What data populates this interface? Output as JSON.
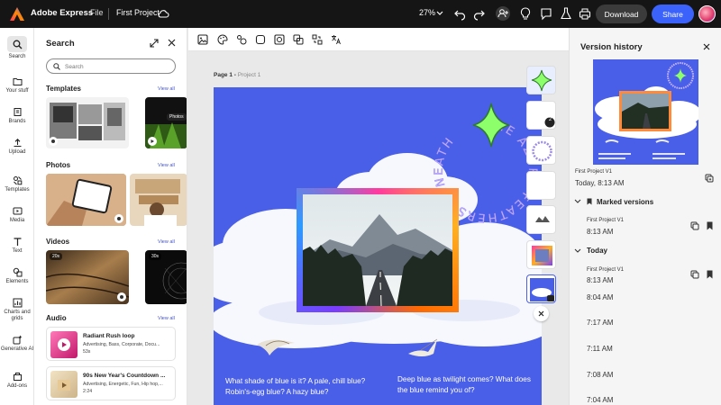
{
  "topbar": {
    "app_name": "Adobe Express",
    "file_menu": "File",
    "project_name": "First Project",
    "zoom": "27%",
    "download_label": "Download",
    "share_label": "Share",
    "icons": [
      "undo-icon",
      "redo-icon",
      "add-user-icon",
      "lightbulb-icon",
      "comment-icon",
      "flask-icon",
      "print-icon"
    ]
  },
  "leftrail": {
    "items": [
      {
        "label": "Search",
        "icon": "search-icon"
      },
      {
        "label": "Your stuff",
        "icon": "folder-icon"
      },
      {
        "label": "Brands",
        "icon": "brand-icon"
      },
      {
        "label": "Upload",
        "icon": "upload-icon"
      },
      {
        "label": "Templates",
        "icon": "templates-icon"
      },
      {
        "label": "Media",
        "icon": "media-icon"
      },
      {
        "label": "Text",
        "icon": "text-icon"
      },
      {
        "label": "Elements",
        "icon": "elements-icon"
      },
      {
        "label": "Charts and grids",
        "icon": "chart-icon"
      },
      {
        "label": "Generative AI",
        "icon": "sparkle-icon"
      },
      {
        "label": "Add-ons",
        "icon": "addons-icon"
      }
    ]
  },
  "search_panel": {
    "title": "Search",
    "placeholder": "Search",
    "view_all": "View all",
    "sections": {
      "templates": "Templates",
      "photos": "Photos",
      "videos": "Videos",
      "audio": "Audio"
    },
    "template_badge": "Photos",
    "videos": [
      {
        "duration": "20s"
      },
      {
        "duration": "30s"
      }
    ],
    "audio": [
      {
        "title": "Radiant Rush loop",
        "tags": "Advertising, Bass, Corporate, Docu...",
        "duration": "53s"
      },
      {
        "title": "90s New Year's Countdown ...",
        "tags": "Advertising, Energetic, Fun, Hip hop,...",
        "duration": "2:24"
      }
    ]
  },
  "canvas": {
    "page_label": "Page 1 - ",
    "page_name": "Project 1",
    "circle_text": "THE AZURE FEATHERS BENEATH",
    "caption_left": "What shade of blue is it? A pale, chill blue? Robin's-egg blue? A hazy blue?",
    "caption_right": "Deep blue as twilight comes? What does the blue remind you of?",
    "strip_count": "2"
  },
  "history": {
    "title": "Version history",
    "current_version": "First Project V1",
    "current_time": "Today, 8:13 AM",
    "marked_label": "Marked versions",
    "marked_version": "First Project V1",
    "today_label": "Today",
    "today_version": "First Project V1",
    "times": [
      "8:13 AM",
      "8:04 AM",
      "7:17 AM",
      "7:11 AM",
      "7:08 AM",
      "7:04 AM"
    ]
  },
  "colors": {
    "accent": "#3b63fb",
    "artboard": "#4a5fe8",
    "topbar": "#151515"
  }
}
